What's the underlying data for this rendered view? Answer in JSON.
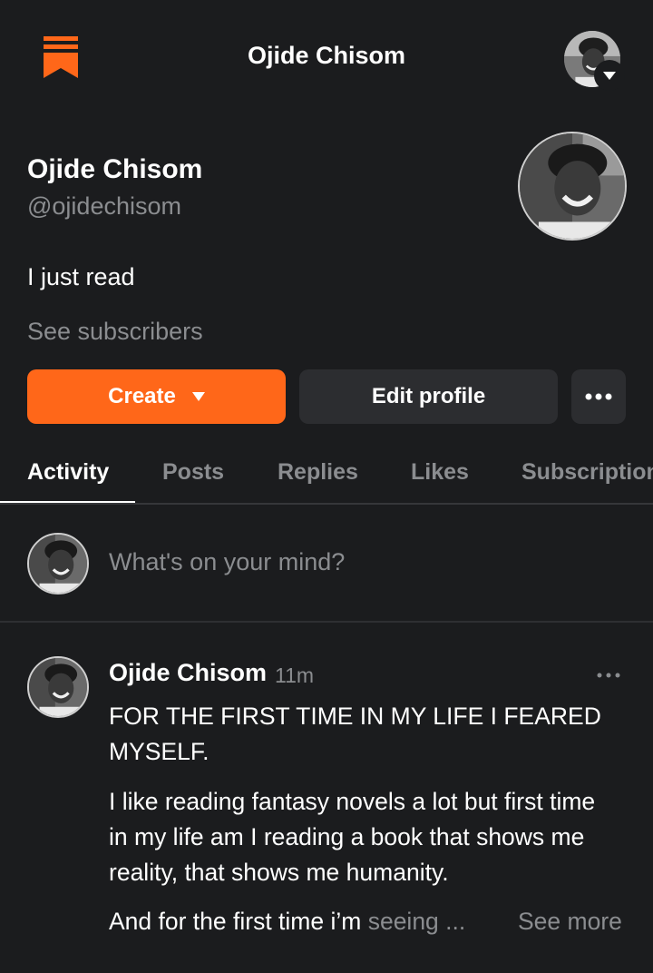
{
  "header": {
    "title": "Ojide Chisom",
    "logo_icon": "bookmark-stack-icon",
    "accent": "#ff6719"
  },
  "profile": {
    "name": "Ojide Chisom",
    "handle": "@ojidechisom",
    "bio": "I just read",
    "see_subscribers": "See subscribers"
  },
  "actions": {
    "create_label": "Create",
    "edit_label": "Edit profile",
    "more_icon": "ellipsis-icon"
  },
  "tabs": [
    {
      "label": "Activity",
      "active": true
    },
    {
      "label": "Posts",
      "active": false
    },
    {
      "label": "Replies",
      "active": false
    },
    {
      "label": "Likes",
      "active": false
    },
    {
      "label": "Subscriptions",
      "active": false
    }
  ],
  "composer": {
    "placeholder": "What's on your mind?"
  },
  "post": {
    "author": "Ojide Chisom",
    "time": "11m",
    "paragraphs": [
      "FOR THE FIRST TIME IN MY LIFE I FEARED MYSELF.",
      "I like reading fantasy novels a lot but first time in my life am I reading a book that shows me reality, that shows me humanity."
    ],
    "truncated_start": "And for the first time i’m ",
    "truncated_fade": "seeing ...",
    "see_more": "See more"
  }
}
